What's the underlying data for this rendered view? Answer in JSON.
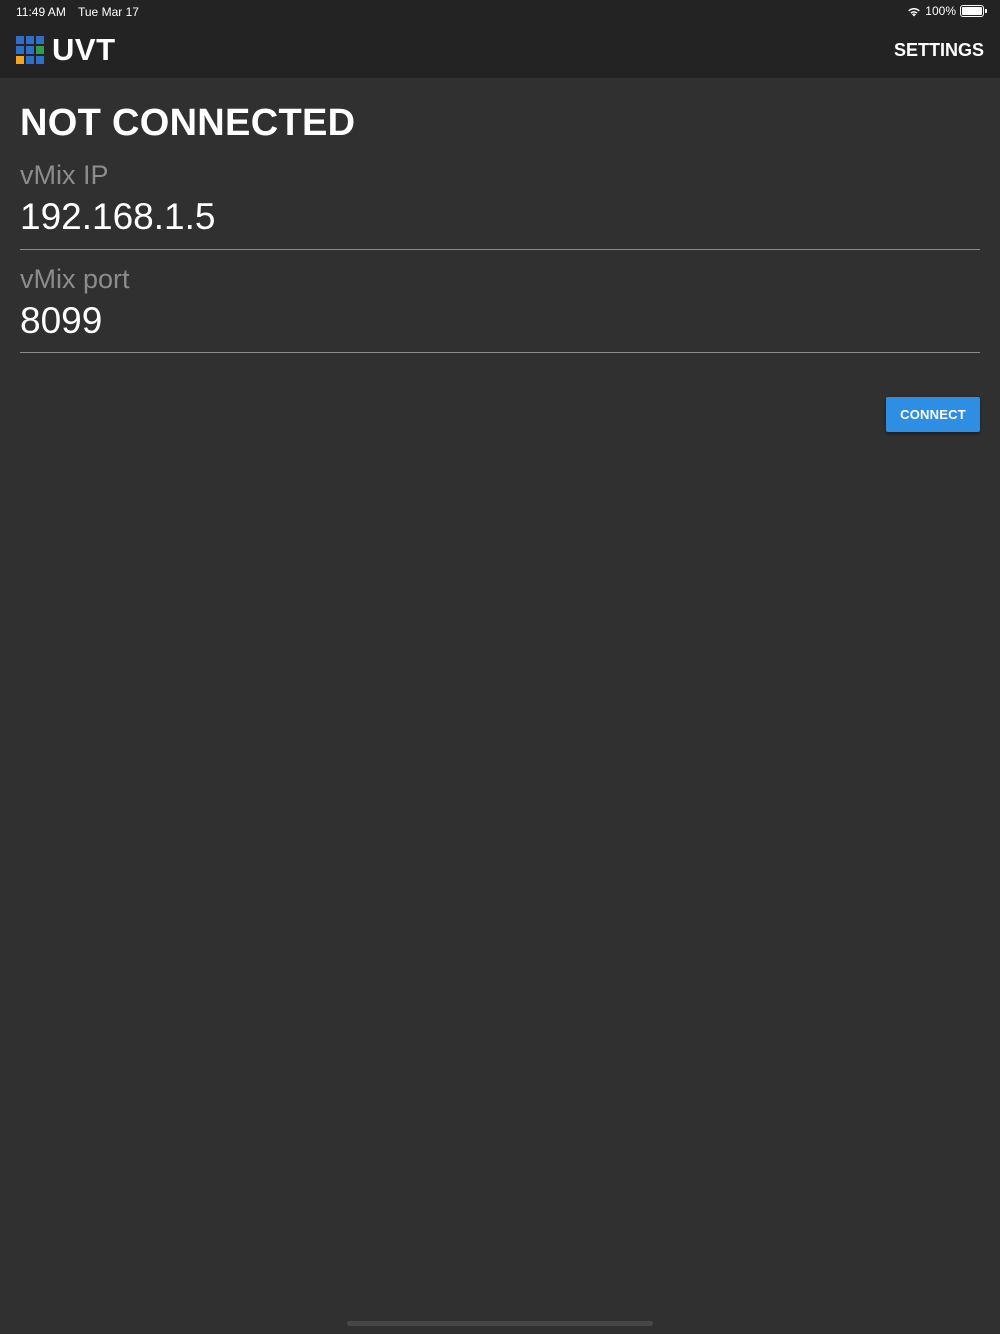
{
  "status_bar": {
    "time": "11:49 AM",
    "date": "Tue Mar 17",
    "battery_text": "100%",
    "battery_level": 1.0
  },
  "header": {
    "app_title": "UVT",
    "settings_label": "SETTINGS"
  },
  "main": {
    "heading": "NOT CONNECTED",
    "ip_field": {
      "label": "vMix IP",
      "value": "192.168.1.5"
    },
    "port_field": {
      "label": "vMix port",
      "value": "8099"
    },
    "connect_label": "CONNECT"
  },
  "colors": {
    "background": "#303030",
    "header_background": "#232323",
    "accent": "#2d8ee3",
    "label_gray": "#8c8c8c",
    "logo_tiles": [
      "#2f6fc9",
      "#2f6fc9",
      "#2f6fc9",
      "#2f6fc9",
      "#2f6fc9",
      "#2e9e4a",
      "#f4a520",
      "#2f6fc9",
      "#2f6fc9"
    ]
  },
  "icons": {
    "logo": "app-logo-grid-icon",
    "wifi": "wifi-icon",
    "battery": "battery-icon"
  }
}
